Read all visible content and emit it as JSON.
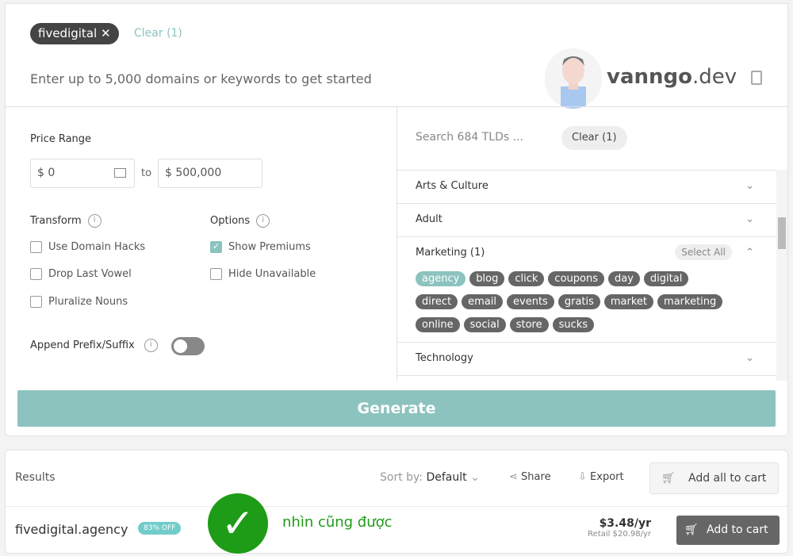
{
  "search": {
    "chip": "fivedigital",
    "chip_close": "✕",
    "clear": "Clear (1)",
    "prompt": "Enter up to 5,000 domains or keywords to get started"
  },
  "watermark": {
    "brand_bold": "vanngo",
    "brand_rest": ".dev"
  },
  "filters": {
    "price_range": "Price Range",
    "price_from": "$  0",
    "to": "to",
    "price_to": "$  500,000",
    "transform": "Transform",
    "options": "Options",
    "info": "i",
    "transform_items": [
      {
        "label": "Use Domain Hacks",
        "checked": false
      },
      {
        "label": "Drop Last Vowel",
        "checked": false
      },
      {
        "label": "Pluralize Nouns",
        "checked": false
      }
    ],
    "option_items": [
      {
        "label": "Show Premiums",
        "checked": true
      },
      {
        "label": "Hide Unavailable",
        "checked": false
      }
    ],
    "append": "Append Prefix/Suffix",
    "append_on": false
  },
  "tlds": {
    "search_placeholder": "Search 684 TLDs ...",
    "clear": "Clear (1)",
    "select_all": "Select All",
    "categories": [
      "Arts & Culture",
      "Adult",
      "Marketing (1)",
      "Technology"
    ],
    "marketing_tags": [
      "agency",
      "blog",
      "click",
      "coupons",
      "day",
      "digital",
      "direct",
      "email",
      "events",
      "gratis",
      "market",
      "marketing",
      "online",
      "social",
      "store",
      "sucks"
    ],
    "selected_tag": "agency"
  },
  "generate": "Generate",
  "results": {
    "title": "Results",
    "sort_label": "Sort by:",
    "sort_value": "Default",
    "share": "Share",
    "export": "Export",
    "add_all": "Add all to cart",
    "items": [
      {
        "domain": "fivedigital.agency",
        "badge": "83% OFF",
        "price": "$3.48/yr",
        "retail": "Retail $20.98/yr",
        "add": "Add to cart"
      }
    ]
  },
  "overlay": {
    "check": "✓",
    "note": "nhìn cũng được",
    "color": "#1e9b17"
  },
  "colors": {
    "accent": "#8cc3bf",
    "dark": "#444444"
  }
}
